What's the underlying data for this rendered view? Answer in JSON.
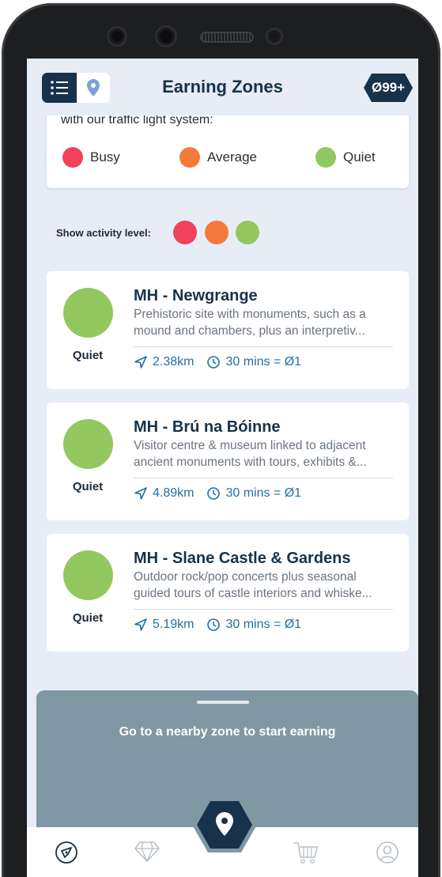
{
  "header": {
    "title": "Earning Zones",
    "balance": "Ø99+"
  },
  "legend": {
    "intro": "with our traffic light system:",
    "items": [
      {
        "label": "Busy",
        "color": "#f2415a"
      },
      {
        "label": "Average",
        "color": "#f47a3c"
      },
      {
        "label": "Quiet",
        "color": "#93c75f"
      }
    ]
  },
  "activity": {
    "label": "Show activity level:",
    "colors": [
      "#f2415a",
      "#f47a3c",
      "#93c75f"
    ]
  },
  "zones": [
    {
      "name": "MH - Newgrange",
      "desc1": "Prehistoric site with monuments, such as a",
      "desc2": "mound and chambers, plus an interpretiv...",
      "status": "Quiet",
      "distance": "2.38km",
      "reward": "30 mins = Ø1"
    },
    {
      "name": "MH - Brú na Bóinne",
      "desc1": "Visitor centre & museum linked to adjacent",
      "desc2": "ancient monuments with tours, exhibits &...",
      "status": "Quiet",
      "distance": "4.89km",
      "reward": "30 mins = Ø1"
    },
    {
      "name": "MH - Slane Castle & Gardens",
      "desc1": "Outdoor rock/pop concerts plus seasonal",
      "desc2": "guided tours of castle interiors and whiske...",
      "status": "Quiet",
      "distance": "5.19km",
      "reward": "30 mins = Ø1"
    }
  ],
  "sheet": {
    "message": "Go to a nearby zone to start earning"
  },
  "nav": {
    "icons": [
      "compass-icon",
      "diamond-icon",
      "location-pin-icon",
      "cart-icon",
      "profile-icon"
    ]
  }
}
